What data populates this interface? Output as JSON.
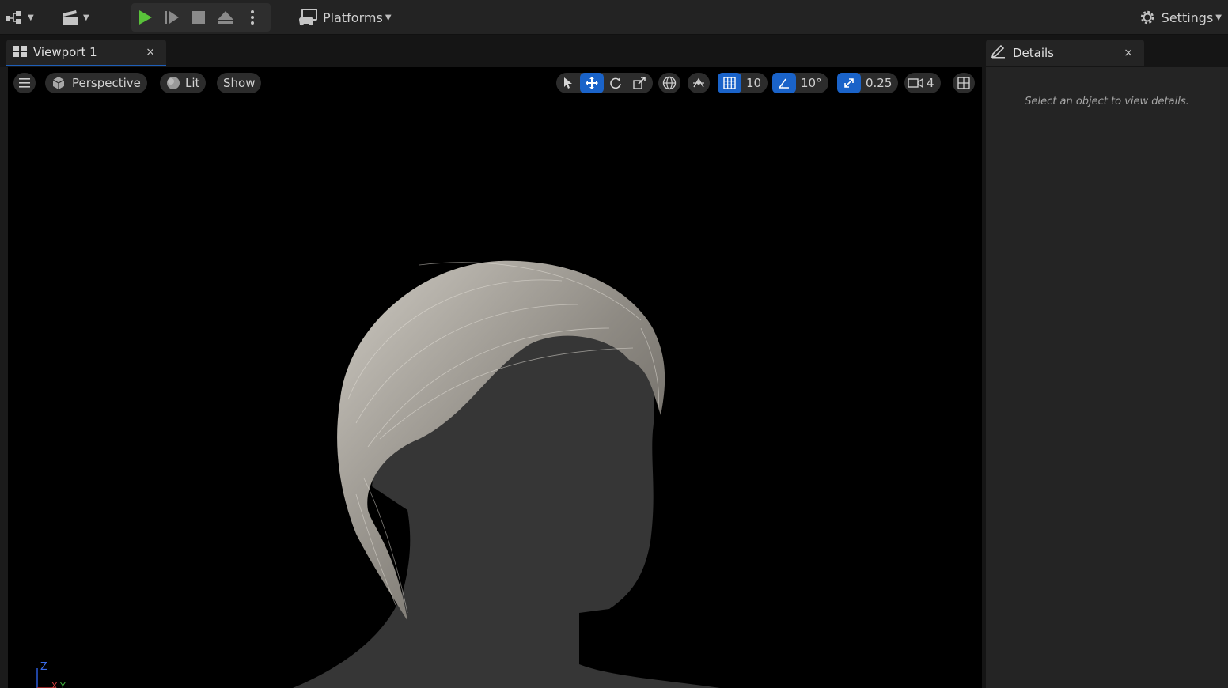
{
  "toolbar": {
    "platforms_label": "Platforms",
    "settings_label": "Settings",
    "icons": [
      "modes-icon",
      "cinematics-icon",
      "play-icon",
      "advance-frame-icon",
      "stop-icon",
      "eject-icon",
      "more-options-icon",
      "platforms-icon",
      "settings-gear-icon"
    ],
    "play_color": "#59c23a"
  },
  "tabs": {
    "viewport": {
      "label": "Viewport 1",
      "close": "×"
    },
    "details": {
      "label": "Details",
      "close": "×"
    }
  },
  "viewport_toolbar": {
    "perspective_label": "Perspective",
    "lit_label": "Lit",
    "show_label": "Show",
    "grid_snap_value": "10",
    "rotation_snap_value": "10°",
    "scale_snap_value": "0.25",
    "camera_speed_value": "4",
    "accent": "#1a63c9"
  },
  "axis_gizmo": {
    "z_label": "Z",
    "x_label": "X",
    "y_label": "Y"
  },
  "details_panel": {
    "empty_hint": "Select an object to view details."
  }
}
